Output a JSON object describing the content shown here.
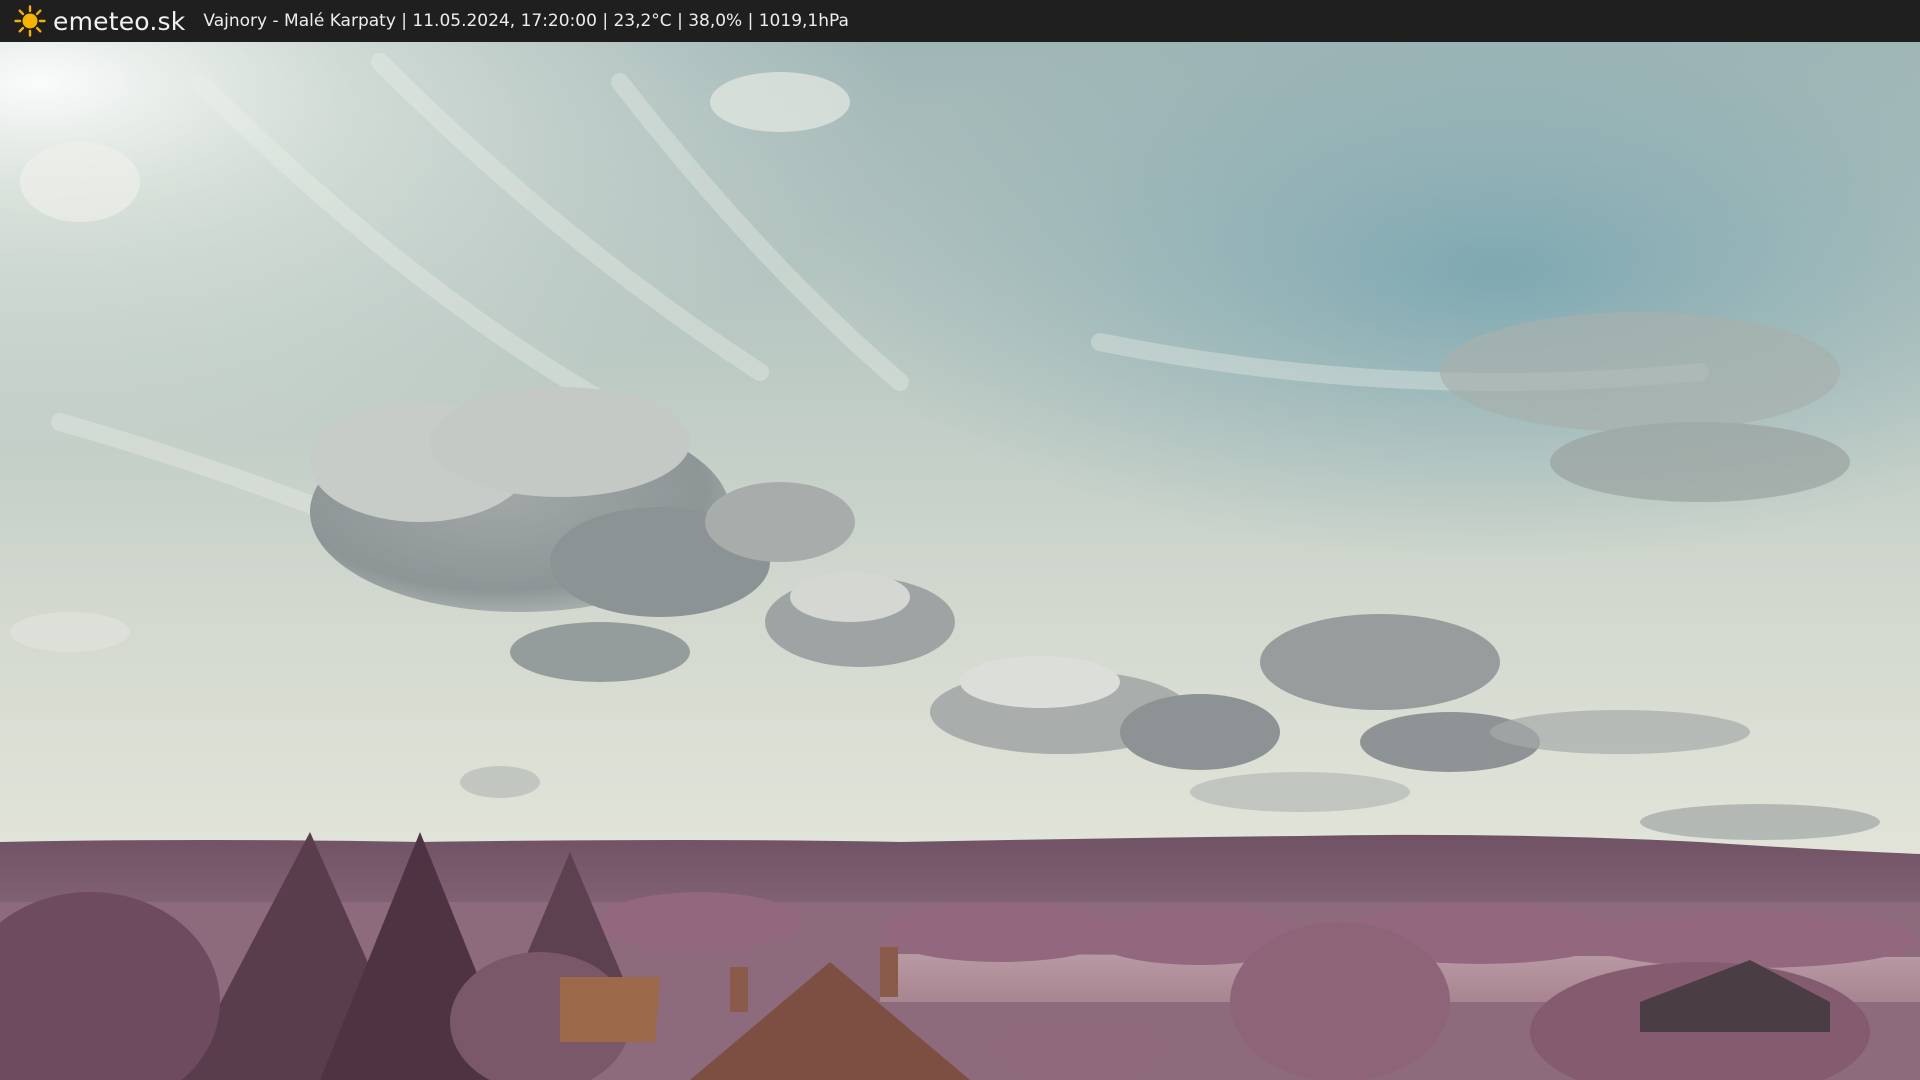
{
  "header": {
    "brand": "emeteo.sk",
    "icon": "sun-icon",
    "caption": "Vajnory - Malé Karpaty | 11.05.2024, 17:20:00 | 23,2°C | 38,0% | 1019,1hPa"
  },
  "colors": {
    "bar_background": "#1f1f1f",
    "sun": "#f5b301",
    "sky_top": "#8fa9ab",
    "sky_horizon": "#dfe3d8",
    "vegetation": "#8a5a73"
  }
}
